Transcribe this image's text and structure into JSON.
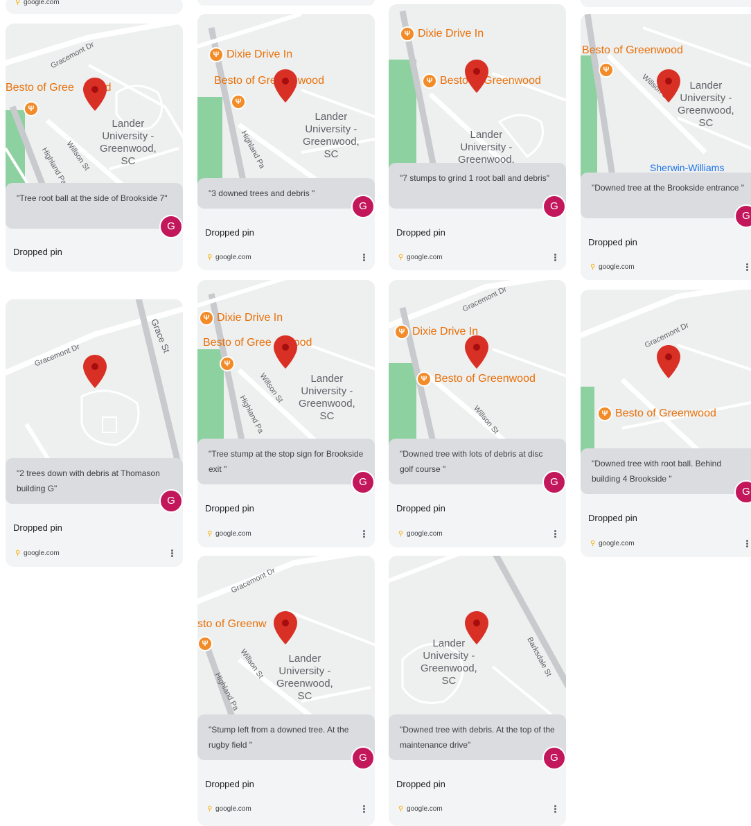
{
  "colors": {
    "accent_badge": "#c2185b",
    "poi": "#e8710a",
    "pin": "#d93025",
    "park": "#8ed1a0",
    "card": "#f3f4f5",
    "caption_bg": "#dadce0"
  },
  "common": {
    "title": "Dropped pin",
    "source": "google.com",
    "badge": "G",
    "pin_icon": "map-pin-icon",
    "source_icon": "location-dot-icon"
  },
  "labels": {
    "dixie": "Dixie Drive In",
    "besto": "Besto of Greenwood",
    "besto_clip": "sto of Greenw",
    "besto_a": "Besto of Gree",
    "besto_b": "od",
    "gracemont": "Gracemont Dr",
    "willson": "Willson St",
    "highland": "Highland Pa",
    "grace": "Grace St",
    "barksdale": "Barksdale St",
    "lander": "Lander",
    "university": "University -",
    "greenwood": "Greenwood,",
    "sc": "SC",
    "sherwin": "Sherwin-Williams"
  },
  "cards": [
    {
      "caption": "\"Tree root ball at the side of Brookside 7\""
    },
    {
      "caption": "\"2 trees down with debris at Thomason building G\""
    },
    {
      "caption": "\"3 downed trees and debris \""
    },
    {
      "caption": "\"Tree stump at the stop sign for Brookside exit \""
    },
    {
      "caption": "\"Stump left from a downed tree. At the rugby field \""
    },
    {
      "caption": "\"7 stumps to grind 1 root ball and debris\""
    },
    {
      "caption": "\"Downed tree with lots of debris at disc golf course \""
    },
    {
      "caption": "\"Downed tree with debris. At the top of the maintenance drive\""
    },
    {
      "caption": "\"Downed tree at the Brookside entrance \""
    },
    {
      "caption": "\"Downed tree with root ball. Behind building 4 Brookside \""
    }
  ]
}
